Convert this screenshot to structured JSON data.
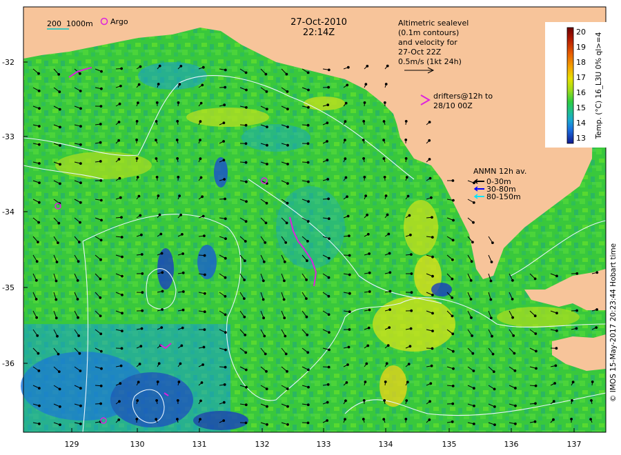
{
  "map": {
    "date": "27-Oct-2010",
    "time": "22:14Z",
    "scale_label": "200  1000m",
    "argo_label": "Argo",
    "altimetry_label": [
      "Altimetric sealevel",
      "(0.1m contours)",
      "and velocity for",
      "27-Oct 22Z",
      "0.5m/s (1kt 24h)"
    ],
    "drifters_label": [
      "drifters@12h to",
      "28/10 00Z"
    ],
    "anmn_title": "ANMN 12h av.",
    "anmn_items": [
      {
        "label": "0-30m",
        "color": "#000000"
      },
      {
        "label": "30-80m",
        "color": "#0000ff"
      },
      {
        "label": "80-150m",
        "color": "#00e5ff"
      }
    ],
    "colorbar": {
      "label": "Temp. (°C) 16_L3U 0% ql>=4",
      "ticks": [
        "20",
        "19",
        "18",
        "17",
        "16",
        "15",
        "14",
        "13"
      ],
      "colors": [
        "#6b0000",
        "#b21a00",
        "#e65a00",
        "#f59b00",
        "#f2d600",
        "#c8e600",
        "#7fd42a",
        "#2ecc40",
        "#1fc07a",
        "#1aa8c8",
        "#1a7fe0",
        "#1a4fd0",
        "#1020a0"
      ]
    },
    "credit": "© IMOS 15-May-2017 20:23:44 Hobart time",
    "lat_labels": [
      "-32",
      "-33",
      "-34",
      "-35",
      "-36"
    ],
    "lon_labels": [
      "129",
      "130",
      "131",
      "132",
      "133",
      "134",
      "135",
      "136",
      "137"
    ],
    "colors": {
      "land": "#f7c49a",
      "sea": "#3fcb3f",
      "contour": "#e8f4ff",
      "drifter": "#dd22dd"
    }
  }
}
